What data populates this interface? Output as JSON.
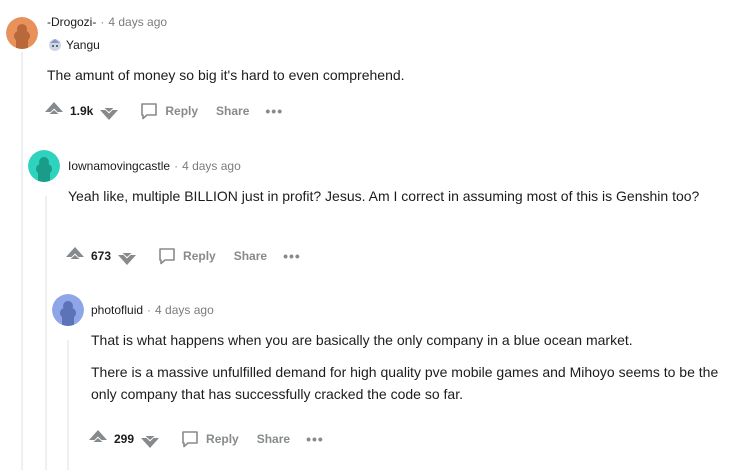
{
  "comments": [
    {
      "author": "-Drogozi-",
      "time": "4 days ago",
      "flair": "Yangu",
      "body": [
        "The amunt of money so big it's hard to even comprehend."
      ],
      "score": "1.9k",
      "reply_label": "Reply",
      "share_label": "Share",
      "more_label": "•••",
      "avatar_color": "#e8915a"
    },
    {
      "author": "Iownamovingcastle",
      "time": "4 days ago",
      "body": [
        "Yeah like, multiple BILLION just in profit? Jesus. Am I correct in assuming most of this is Genshin too?"
      ],
      "score": "673",
      "reply_label": "Reply",
      "share_label": "Share",
      "more_label": "•••",
      "avatar_color": "#2ed3bd"
    },
    {
      "author": "photofluid",
      "time": "4 days ago",
      "body": [
        "That is what happens when you are basically the only company in a blue ocean market.",
        "There is a massive unfulfilled demand for high quality pve mobile games and Mihoyo seems to be the only company that has successfully cracked the code so far."
      ],
      "score": "299",
      "reply_label": "Reply",
      "share_label": "Share",
      "more_label": "•••",
      "avatar_color": "#8ea5e8"
    }
  ],
  "separator": "·"
}
